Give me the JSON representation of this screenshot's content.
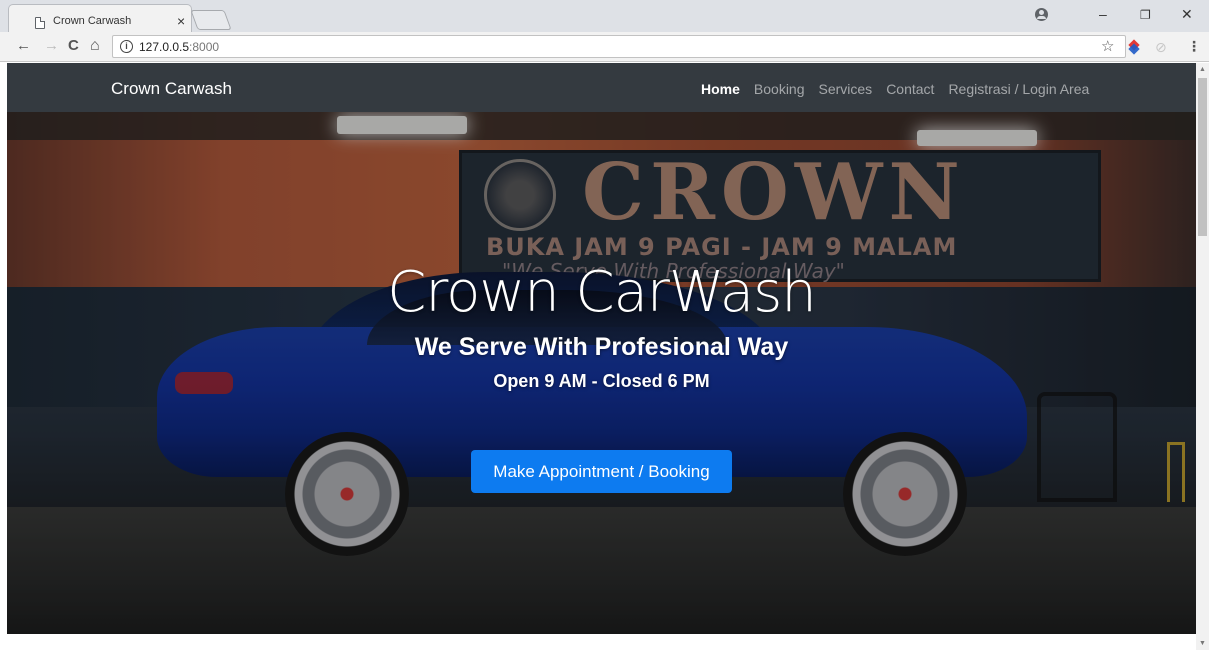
{
  "browser": {
    "tab_title": "Crown Carwash",
    "tab_close": "×",
    "back_glyph": "←",
    "forward_glyph": "→",
    "reload_glyph": "C",
    "home_glyph": "⌂",
    "url_host": "127.0.0.5",
    "url_port": ":8000",
    "info_glyph": "i",
    "star_glyph": "☆",
    "ext2_glyph": "⊘",
    "menu_glyph": "⋮",
    "minimize_glyph": "–",
    "restore_glyph": "❐",
    "close_glyph": "✕"
  },
  "navbar": {
    "brand": "Crown Carwash",
    "links": [
      {
        "label": "Home",
        "active": true
      },
      {
        "label": "Booking",
        "active": false
      },
      {
        "label": "Services",
        "active": false
      },
      {
        "label": "Contact",
        "active": false
      },
      {
        "label": "Registrasi / Login Area",
        "active": false
      }
    ],
    "background": "#343a40"
  },
  "hero": {
    "title": "Crown CarWash",
    "tagline": "We Serve With Profesional Way",
    "hours": "Open 9 AM - Closed 6 PM",
    "cta_label": "Make Appointment / Booking",
    "cta_color": "#0d7bf0",
    "photo": {
      "banner_word": "CROWN",
      "banner_hours": "BUKA JAM 9 PAGI - JAM 9 MALAM",
      "banner_tag": "\"We Serve With Professional Way\""
    }
  }
}
